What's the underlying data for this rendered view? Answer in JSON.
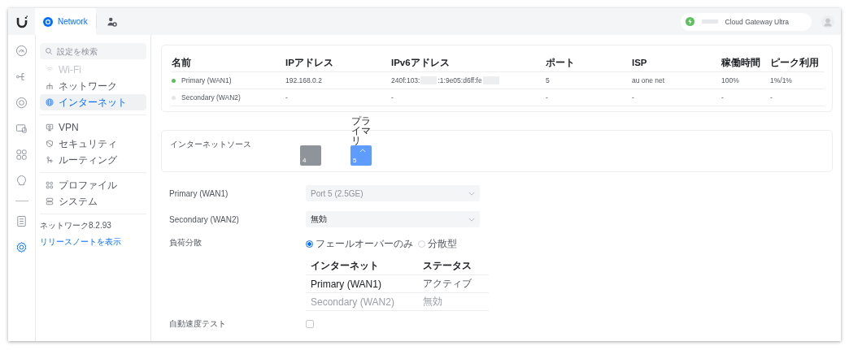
{
  "topbar": {
    "tabs": [
      {
        "kind": "network",
        "label": "Network",
        "selected": true
      },
      {
        "kind": "users",
        "selected": false
      }
    ],
    "device": {
      "name": "Cloud Gateway Ultra",
      "online": true
    }
  },
  "rail": [
    {
      "kind": "dashboard",
      "selected": false
    },
    {
      "kind": "topology",
      "selected": false
    },
    {
      "kind": "devices",
      "selected": false
    },
    {
      "kind": "clients",
      "selected": false
    },
    {
      "kind": "apps",
      "selected": false
    },
    {
      "kind": "insights",
      "selected": false
    },
    {
      "kind": "logs",
      "selected": false
    },
    {
      "kind": "settings",
      "selected": true
    }
  ],
  "sidebar": {
    "search": {
      "placeholder": "設定を検索"
    },
    "groups": [
      [
        {
          "kind": "wifi",
          "label": "Wi-Fi",
          "disabled": true,
          "selected": false
        },
        {
          "kind": "network",
          "label": "ネットワーク",
          "disabled": false,
          "selected": false
        },
        {
          "kind": "globe",
          "label": "インターネット",
          "disabled": false,
          "selected": true
        }
      ],
      [
        {
          "kind": "vpn",
          "label": "VPN",
          "disabled": false,
          "selected": false
        },
        {
          "kind": "shield",
          "label": "セキュリティ",
          "disabled": false,
          "selected": false
        },
        {
          "kind": "routing",
          "label": "ルーティング",
          "disabled": false,
          "selected": false
        }
      ],
      [
        {
          "kind": "profiles",
          "label": "プロファイル",
          "disabled": false,
          "selected": false
        },
        {
          "kind": "system",
          "label": "システム",
          "disabled": false,
          "selected": false
        }
      ]
    ],
    "version": "ネットワーク8.2.93",
    "release_link": "リリースノートを表示"
  },
  "wan_table": {
    "columns": [
      "名前",
      "IPアドレス",
      "IPv6アドレス",
      "ポート",
      "ISP",
      "稼働時間",
      "ピーク利用"
    ],
    "rows": [
      {
        "color": "#5cc05f",
        "name": "Primary (WAN1)",
        "ip": "192.168.0.2",
        "ipv6": [
          "240f:103:",
          ":1:9e05:d6ff:fe"
        ],
        "port": "5",
        "isp": "au one net",
        "uptime": "100%",
        "peak": "1%/1%"
      },
      {
        "color": "#e4e6e9",
        "name": "Secondary (WAN2)",
        "ip": "-",
        "ipv6": [
          "-"
        ],
        "port": "-",
        "isp": "-",
        "uptime": "-",
        "peak": "-"
      }
    ]
  },
  "internet_source": {
    "label": "インターネットソース",
    "ports": [
      {
        "number": "4",
        "selected": false
      },
      {
        "number": "5",
        "selected": true,
        "tag": "プライマリ"
      }
    ]
  },
  "form": {
    "selects": [
      {
        "label": "Primary (WAN1)",
        "value": "Port 5 (2.5GE)",
        "disabled": true
      },
      {
        "label": "Secondary (WAN2)",
        "value": "無効",
        "disabled": false
      }
    ],
    "load_balancing": {
      "label": "負荷分散",
      "options": [
        {
          "label": "フェールオーバーのみ",
          "selected": true
        },
        {
          "label": "分散型",
          "selected": false
        }
      ],
      "table": {
        "columns": [
          "インターネット",
          "ステータス"
        ],
        "rows": [
          {
            "name": "Primary (WAN1)",
            "status": "アクティブ",
            "active": true
          },
          {
            "name": "Secondary (WAN2)",
            "status": "無効",
            "active": false
          }
        ]
      }
    },
    "speed_test": {
      "label": "自動速度テスト",
      "checked": false
    }
  }
}
